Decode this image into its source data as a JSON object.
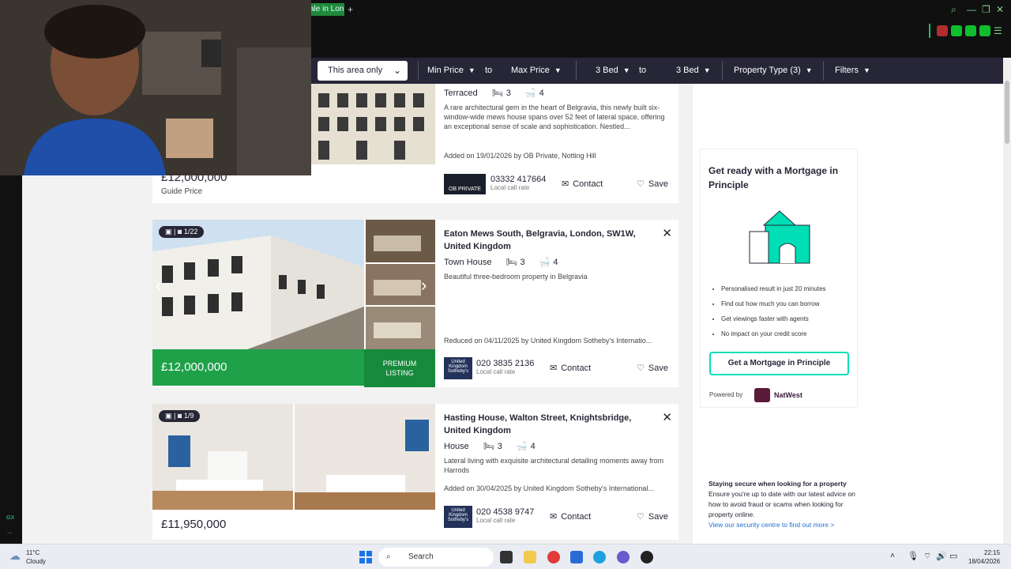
{
  "browser": {
    "tab_title": "ale in Lon",
    "tab_plus": "+"
  },
  "filters": {
    "area": "This area only",
    "min_price": "Min Price",
    "to1": "to",
    "max_price": "Max Price",
    "min_bed": "3 Bed",
    "to2": "to",
    "max_bed": "3 Bed",
    "property_type": "Property Type (3)",
    "filters": "Filters"
  },
  "listings": [
    {
      "type": "Terraced",
      "beds": "3",
      "baths": "4",
      "description": "A rare architectural gem in the heart of Belgravia, this newly built six-window-wide mews house spans over 52 feet of lateral space, offering an exceptional sense of scale and sophistication. Nestled...",
      "added": "Added on 19/01/2026 by OB Private, Notting Hill",
      "agent_logo": "OB PRIVATE",
      "phone": "03332 417664",
      "phone_note": "Local call rate",
      "contact": "Contact",
      "save": "Save",
      "price": "£12,000,000",
      "price_qualifier": "Guide Price"
    },
    {
      "address": "Eaton Mews South, Belgravia, London, SW1W, United Kingdom",
      "type": "Town House",
      "beds": "3",
      "baths": "4",
      "description": "Beautiful three-bedroom property in Belgravia",
      "added": "Reduced on 04/11/2025 by United Kingdom Sotheby's Internatio...",
      "agent_logo": "United Kingdom Sotheby's",
      "phone": "020 3835 2136",
      "phone_note": "Local call rate",
      "contact": "Contact",
      "save": "Save",
      "price": "£12,000,000",
      "premium": "PREMIUM LISTING",
      "counter": "1/22",
      "close": "✕"
    },
    {
      "address": "Hasting House, Walton Street, Knightsbridge, United Kingdom",
      "type": "House",
      "beds": "3",
      "baths": "4",
      "description": "Lateral living with exquisite architectural detailing moments away from Harrods",
      "added": "Added on 30/04/2025 by United Kingdom Sotheby's International...",
      "agent_logo": "United Kingdom Sotheby's",
      "phone": "020 4538 9747",
      "phone_note": "Local call rate",
      "contact": "Contact",
      "save": "Save",
      "price": "£11,950,000",
      "counter": "1/9",
      "close": "✕"
    }
  ],
  "mortgage": {
    "title": "Get ready with a Mortgage in Principle",
    "bullets": [
      "Personalised result in just 20 minutes",
      "Find out how much you can borrow",
      "Get viewings faster with agents",
      "No impact on your credit score"
    ],
    "button": "Get a Mortgage in Principle",
    "powered_by": "Powered by",
    "provider": "NatWest"
  },
  "secure": {
    "title": "Staying secure when looking for a property",
    "text": "Ensure you're up to date with our latest advice on how to avoid fraud or scams when looking for property online.",
    "link": "View our security centre to find out more >"
  },
  "taskbar": {
    "weather_temp": "11°C",
    "weather_desc": "Cloudy",
    "search": "Search",
    "time": "22:15",
    "date": "18/04/2026"
  },
  "leftbar": {
    "gx": "GX",
    "dots": "..."
  },
  "colors": {
    "brand_green": "#1fa14a",
    "mint": "#00deb6",
    "navy": "#262637"
  }
}
